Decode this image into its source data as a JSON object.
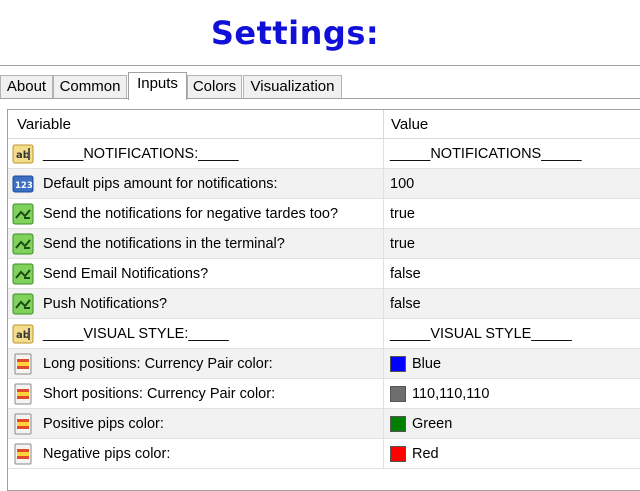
{
  "page_title": "Settings:",
  "tabs": [
    {
      "label": "About",
      "active": false
    },
    {
      "label": "Common",
      "active": false
    },
    {
      "label": "Inputs",
      "active": true
    },
    {
      "label": "Colors",
      "active": false
    },
    {
      "label": "Visualization",
      "active": false
    }
  ],
  "table": {
    "headers": {
      "variable": "Variable",
      "value": "Value"
    },
    "rows": [
      {
        "icon": "string-icon",
        "variable": "_____NOTIFICATIONS:_____",
        "value": "_____NOTIFICATIONS_____"
      },
      {
        "icon": "integer-icon",
        "variable": "Default pips amount for notifications:",
        "value": "100"
      },
      {
        "icon": "boolean-icon",
        "variable": "Send the notifications for negative tardes too?",
        "value": "true"
      },
      {
        "icon": "boolean-icon",
        "variable": "Send the notifications in the terminal?",
        "value": "true"
      },
      {
        "icon": "boolean-icon",
        "variable": "Send Email Notifications?",
        "value": "false"
      },
      {
        "icon": "boolean-icon",
        "variable": "Push Notifications?",
        "value": "false"
      },
      {
        "icon": "string-icon",
        "variable": "_____VISUAL STYLE:_____",
        "value": "_____VISUAL STYLE_____"
      },
      {
        "icon": "color-icon",
        "variable": "Long positions: Currency Pair color:",
        "value": "Blue",
        "swatch": "#0000ff"
      },
      {
        "icon": "color-icon",
        "variable": "Short positions: Currency Pair color:",
        "value": "110,110,110",
        "swatch": "#6e6e6e"
      },
      {
        "icon": "color-icon",
        "variable": "Positive pips color:",
        "value": "Green",
        "swatch": "#008000"
      },
      {
        "icon": "color-icon",
        "variable": "Negative pips color:",
        "value": "Red",
        "swatch": "#ff0000"
      }
    ]
  },
  "colors": {
    "title": "#1010d8"
  }
}
